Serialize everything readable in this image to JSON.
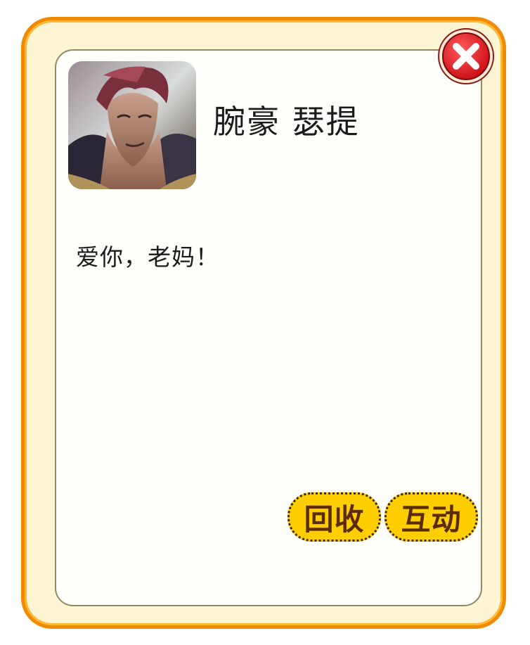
{
  "profile": {
    "avatar": "avatar-portrait",
    "name": "腕豪 瑟提"
  },
  "message": {
    "text": "爱你，老妈！"
  },
  "actions": {
    "recycle_label": "回收",
    "interact_label": "互动"
  },
  "close": {
    "icon": "close-icon"
  },
  "colors": {
    "frame_border": "#f08a00",
    "frame_fill": "#fdf5d4",
    "panel_fill": "#fefefb",
    "button_fill": "#ffce00",
    "button_text": "#5a2c00",
    "close_red": "#e3161c"
  }
}
